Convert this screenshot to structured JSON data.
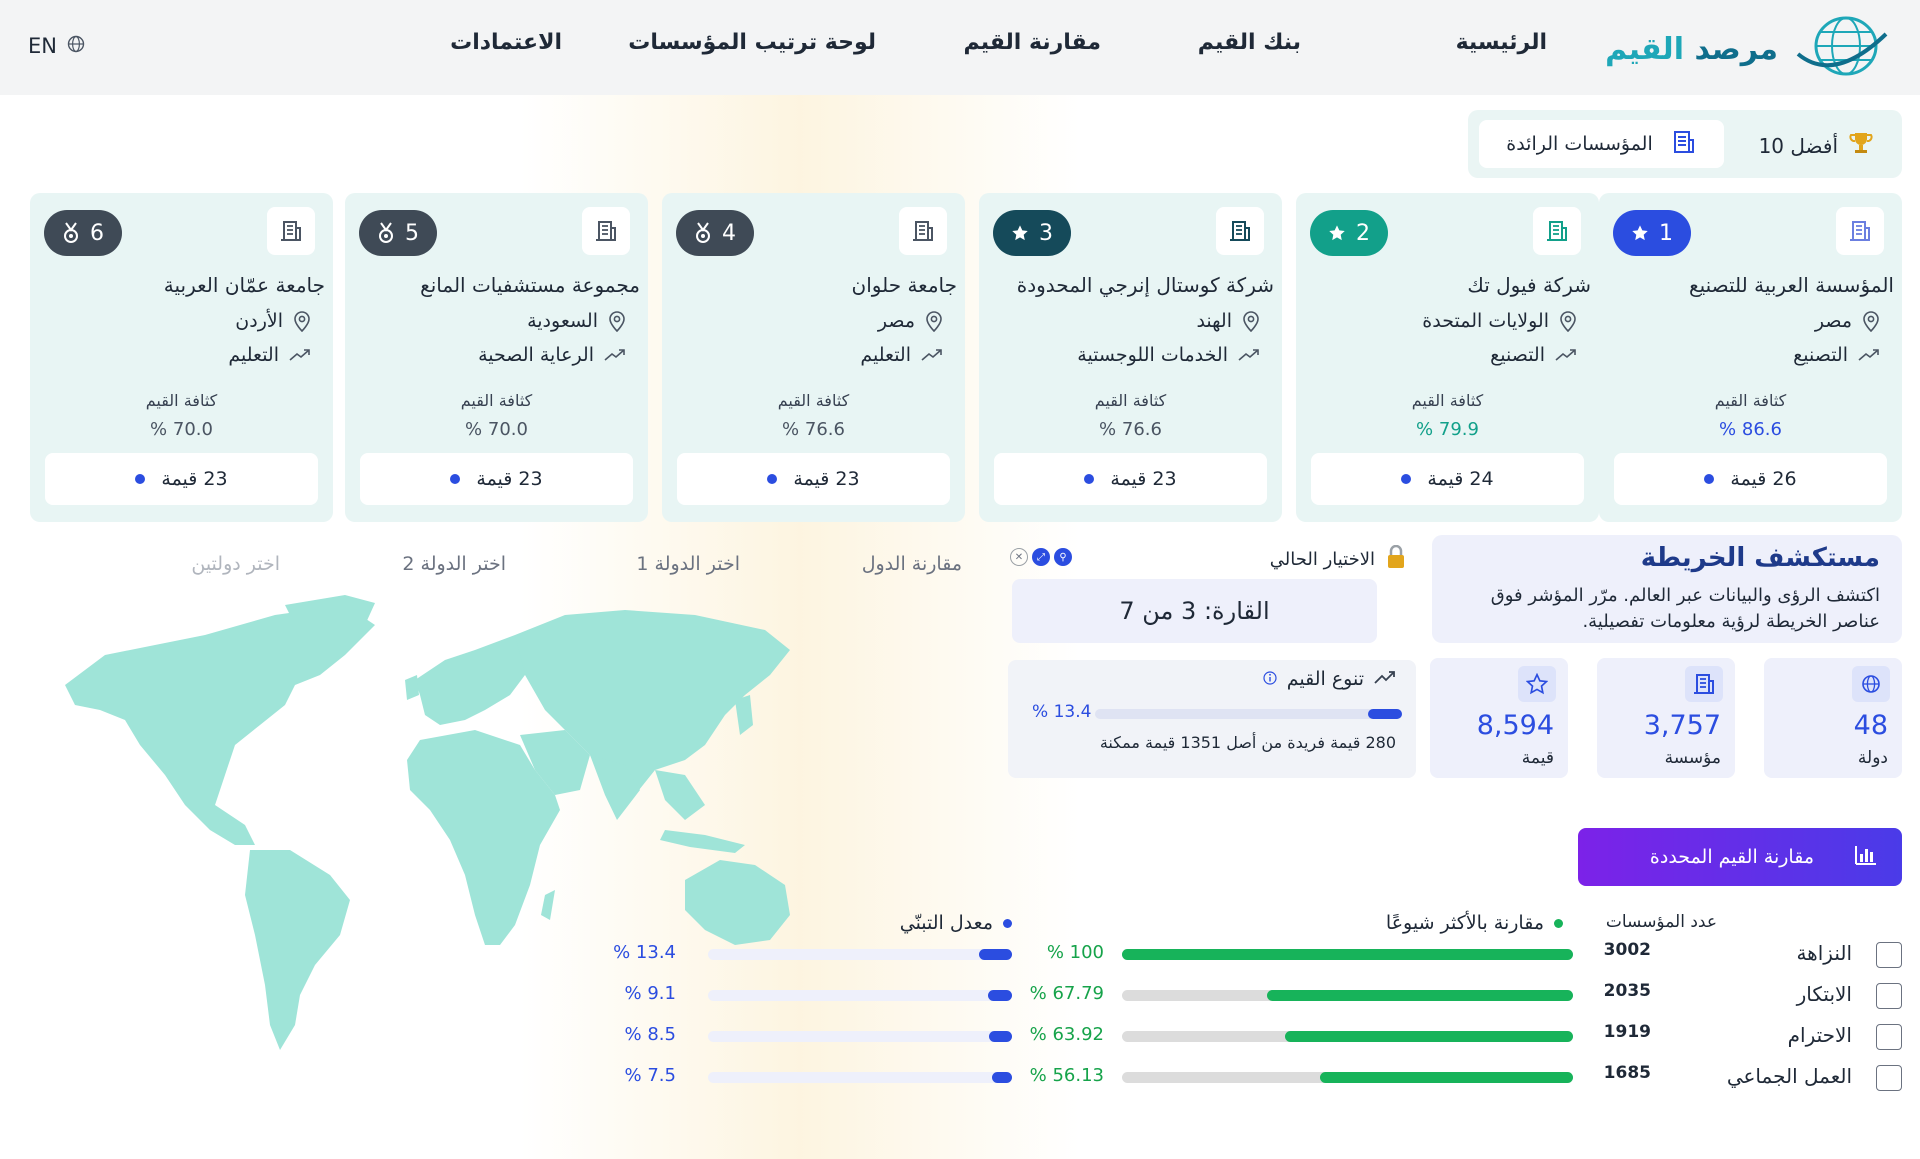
{
  "brand": {
    "part1": "مرصد",
    "part2": "القيم"
  },
  "nav": {
    "items": [
      "الرئيسية",
      "بنك القيم",
      "مقارنة القيم",
      "لوحة ترتيب المؤسسات",
      "الاعتمادات"
    ],
    "lang": "EN"
  },
  "top_panel": {
    "best": "أفضل 10",
    "tab": "المؤسسات الرائدة"
  },
  "cards": [
    {
      "rank": "1",
      "name": "المؤسسة العربية للتصنيع",
      "country": "مصر",
      "sector": "التصنيع",
      "density_label": "كثافة القيم",
      "density": "86.6 %",
      "count": "26 قيمة",
      "badge_color": "#2b4de0",
      "value_color": "#2b4de0",
      "badge_icon": "star"
    },
    {
      "rank": "2",
      "name": "شركة فيول تك",
      "country": "الولايات المتحدة",
      "sector": "التصنيع",
      "density_label": "كثافة القيم",
      "density": "79.9 %",
      "count": "24 قيمة",
      "badge_color": "#12a08a",
      "value_color": "#12a08a",
      "badge_icon": "star"
    },
    {
      "rank": "3",
      "name": "شركة كوستال إنرجي المحدودة",
      "country": "الهند",
      "sector": "الخدمات اللوجستية",
      "density_label": "كثافة القيم",
      "density": "76.6 %",
      "count": "23 قيمة",
      "badge_color": "#154a5a",
      "value_color": "#4b5563",
      "badge_icon": "star"
    },
    {
      "rank": "4",
      "name": "جامعة حلوان",
      "country": "مصر",
      "sector": "التعليم",
      "density_label": "كثافة القيم",
      "density": "76.6 %",
      "count": "23 قيمة",
      "badge_color": "#3f4a56",
      "value_color": "#4b5563",
      "badge_icon": "medal"
    },
    {
      "rank": "5",
      "name": "مجموعة مستشفيات المانع",
      "country": "السعودية",
      "sector": "الرعاية الصحية",
      "density_label": "كثافة القيم",
      "density": "70.0 %",
      "count": "23 قيمة",
      "badge_color": "#3f4a56",
      "value_color": "#4b5563",
      "badge_icon": "medal"
    },
    {
      "rank": "6",
      "name": "جامعة عمّان العربية",
      "country": "الأردن",
      "sector": "التعليم",
      "density_label": "كثافة القيم",
      "density": "70.0 %",
      "count": "23 قيمة",
      "badge_color": "#3f4a56",
      "value_color": "#4b5563",
      "badge_icon": "medal"
    }
  ],
  "explorer": {
    "title": "مستكشف الخريطة",
    "desc": "اكتشف الرؤى والبيانات عبر العالم. مرّر المؤشر فوق عناصر الخريطة لرؤية معلومات تفصيلية."
  },
  "current": {
    "label": "الاختيار الحالي",
    "value": "القارة: 3 من 7"
  },
  "diversity": {
    "title": "تنوع القيم",
    "pct": "13.4 %",
    "fill": 0.11,
    "note": "280 قيمة فريدة من أصل 1351 قيمة ممكنة"
  },
  "stats": [
    {
      "value": "48",
      "label": "دولة",
      "icon": "globe-icon"
    },
    {
      "value": "3,757",
      "label": "مؤسسة",
      "icon": "building-icon"
    },
    {
      "value": "8,594",
      "label": "قيمة",
      "icon": "star-icon"
    }
  ],
  "compare_tabs": [
    "مقارنة الدول",
    "اختر الدولة 1",
    "اختر الدولة 2",
    "اختر دولتين"
  ],
  "compare_button": "مقارنة القيم المحددة",
  "table_headers": {
    "count": "عدد المؤسسات",
    "popular": "مقارنة بالأكثر شيوعًا",
    "adoption": "معدل التبنّي"
  },
  "values": [
    {
      "name": "النزاهة",
      "count": "3002",
      "popular": "100 %",
      "popular_frac": 1.0,
      "adoption": "13.4 %",
      "adoption_frac": 0.11
    },
    {
      "name": "الابتكار",
      "count": "2035",
      "popular": "67.79 %",
      "popular_frac": 0.6779,
      "adoption": "9.1 %",
      "adoption_frac": 0.08
    },
    {
      "name": "الاحترام",
      "count": "1919",
      "popular": "63.92 %",
      "popular_frac": 0.6392,
      "adoption": "8.5 %",
      "adoption_frac": 0.075
    },
    {
      "name": "العمل الجماعي",
      "count": "1685",
      "popular": "56.13 %",
      "popular_frac": 0.5613,
      "adoption": "7.5 %",
      "adoption_frac": 0.066
    }
  ],
  "colors": {
    "map": "#9fe4d8",
    "primary": "#2b4de0",
    "green": "#17b35a"
  }
}
